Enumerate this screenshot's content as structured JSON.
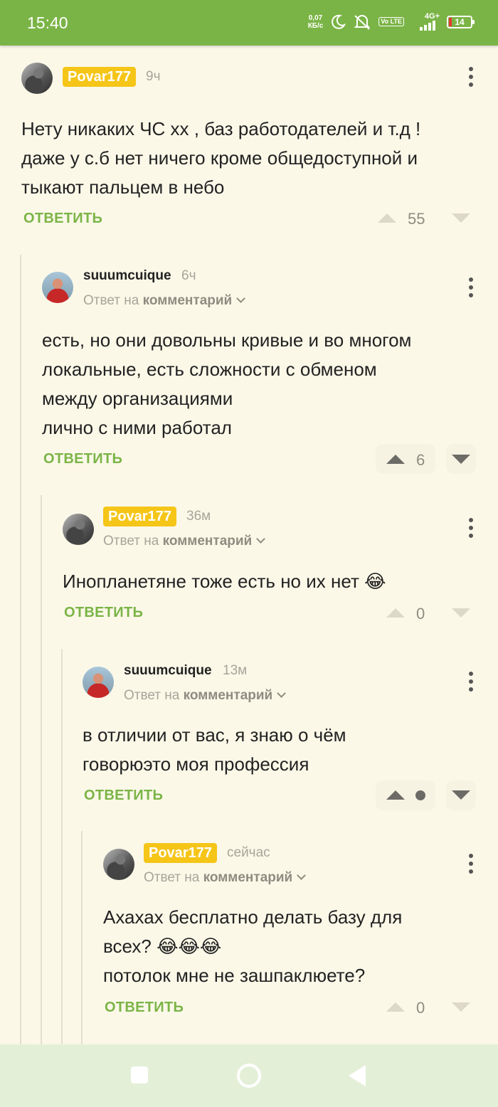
{
  "status_bar": {
    "time": "15:40",
    "net_speed_value": "0,07",
    "net_speed_unit": "КБ/с",
    "network": "4G+",
    "volte": "Vo LTE",
    "battery": "14",
    "icons": [
      "moon-icon",
      "alarm-off-icon",
      "signal-icon"
    ]
  },
  "ui": {
    "reply_label": "ОТВЕТИТЬ",
    "reply_to_prefix": "Ответ на",
    "reply_to_link": "комментарий"
  },
  "comments": [
    {
      "author": "Povar177",
      "author_badge": true,
      "time": "9ч",
      "text": "Нету никаких ЧС хх , баз работодателей и т.д !\nдаже у с.б нет ничего кроме общедоступной и\nтыкают пальцем в небо",
      "votes": "55"
    },
    {
      "author": "suuumcuique",
      "author_badge": false,
      "time": "6ч",
      "text": "есть, но они довольны кривые и во многом\nлокальные, есть сложности с обменом\nмежду организациями\nлично с ними работал",
      "votes": "6"
    },
    {
      "author": "Povar177",
      "author_badge": true,
      "time": "36м",
      "text": "Инопланетяне тоже есть но их нет 😂",
      "votes": "0"
    },
    {
      "author": "suuumcuique",
      "author_badge": false,
      "time": "13м",
      "text": "в отличии от вас, я знаю о чём\nговорюэто моя профессия",
      "votes": ""
    },
    {
      "author": "Povar177",
      "author_badge": true,
      "time": "сейчас",
      "text": "Ахахах бесплатно делать базу для\nвсех? 😂😂😂\nпотолок мне не зашпаклюете?",
      "votes": "0"
    }
  ],
  "colors": {
    "accent_green": "#7bb446",
    "badge_yellow": "#f5c518",
    "background": "#fbf8e8"
  }
}
